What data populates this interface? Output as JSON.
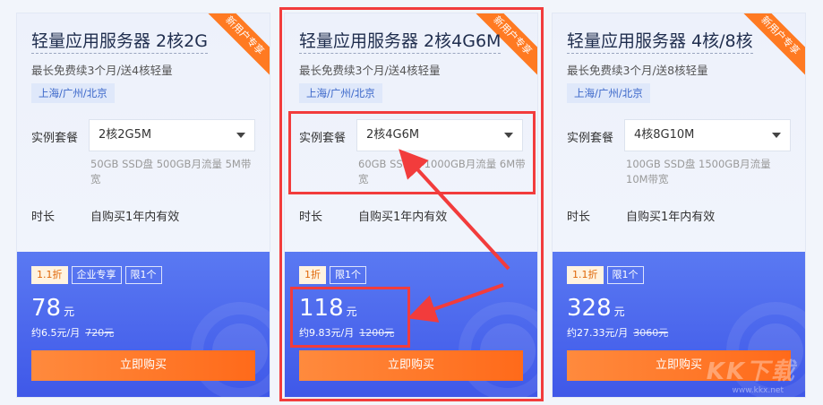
{
  "cards": [
    {
      "ribbon": "新用户专享",
      "title": "轻量应用服务器 2核2G",
      "subtitle": "最长免费续3个月/送4核轻量",
      "region": "上海/广州/北京",
      "spec_label": "实例套餐",
      "spec_value": "2核2G5M",
      "spec_desc": "50GB SSD盘 500GB月流量 5M带宽",
      "duration_label": "时长",
      "duration_value": "自购买1年内有效",
      "badges": [
        "1.1折",
        "企业专享",
        "限1个"
      ],
      "price": "78",
      "price_unit": "元",
      "monthly": "约6.5元/月",
      "original_price": "720元",
      "buy_label": "立即购买"
    },
    {
      "ribbon": "新用户专享",
      "title": "轻量应用服务器 2核4G6M",
      "subtitle": "最长免费续3个月/送4核轻量",
      "region": "上海/广州/北京",
      "spec_label": "实例套餐",
      "spec_value": "2核4G6M",
      "spec_desc": "60GB SSD盘 1000GB月流量 6M带宽",
      "duration_label": "时长",
      "duration_value": "自购买1年内有效",
      "badges": [
        "1折",
        "限1个"
      ],
      "price": "118",
      "price_unit": "元",
      "monthly": "约9.83元/月",
      "original_price": "1200元",
      "buy_label": "立即购买"
    },
    {
      "ribbon": "新用户专享",
      "title": "轻量应用服务器 4核/8核",
      "subtitle": "最长免费续3个月/送8核轻量",
      "region": "上海/广州/北京",
      "spec_label": "实例套餐",
      "spec_value": "4核8G10M",
      "spec_desc": "100GB SSD盘 1500GB月流量 10M带宽",
      "duration_label": "时长",
      "duration_value": "自购买1年内有效",
      "badges": [
        "1.1折",
        "限1个"
      ],
      "price": "328",
      "price_unit": "元",
      "monthly": "约27.33元/月",
      "original_price": "3060元",
      "buy_label": "立即购买"
    }
  ],
  "watermark": {
    "main": "KK下载",
    "sub": "www.kkx.net"
  },
  "colors": {
    "annotation_red": "#f23c3c",
    "price_panel": "#4a64ee",
    "buy_button": "#ff7a22",
    "ribbon": "#ff7a22"
  }
}
